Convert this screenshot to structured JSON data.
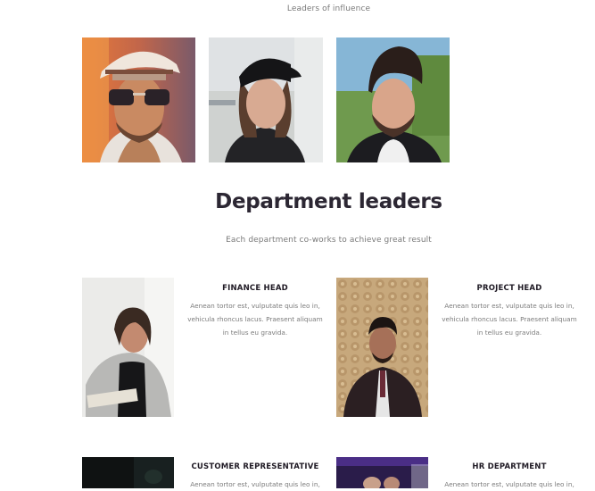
{
  "top_subtitle": "Leaders of influence",
  "influence_photos": [
    {
      "icon": "man-sunglasses-cap-photo"
    },
    {
      "icon": "woman-black-cap-photo"
    },
    {
      "icon": "man-styled-hair-photo"
    }
  ],
  "department": {
    "title": "Department leaders",
    "subtitle": "Each department co-works to achieve great result"
  },
  "cards": [
    {
      "title": "FINANCE HEAD",
      "text": "Aenean tortor est, vulputate quis leo in, vehicula rhoncus lacus. Praesent aliquam in tellus eu gravida."
    },
    {
      "title": "PROJECT HEAD",
      "text": "Aenean tortor est, vulputate quis leo in, vehicula rhoncus lacus. Praesent aliquam in tellus eu gravida."
    },
    {
      "title": "CUSTOMER REPRESENTATIVE",
      "text": "Aenean tortor est, vulputate quis leo in,"
    },
    {
      "title": "HR DEPARTMENT",
      "text": "Aenean tortor est, vulputate quis leo in,"
    }
  ]
}
